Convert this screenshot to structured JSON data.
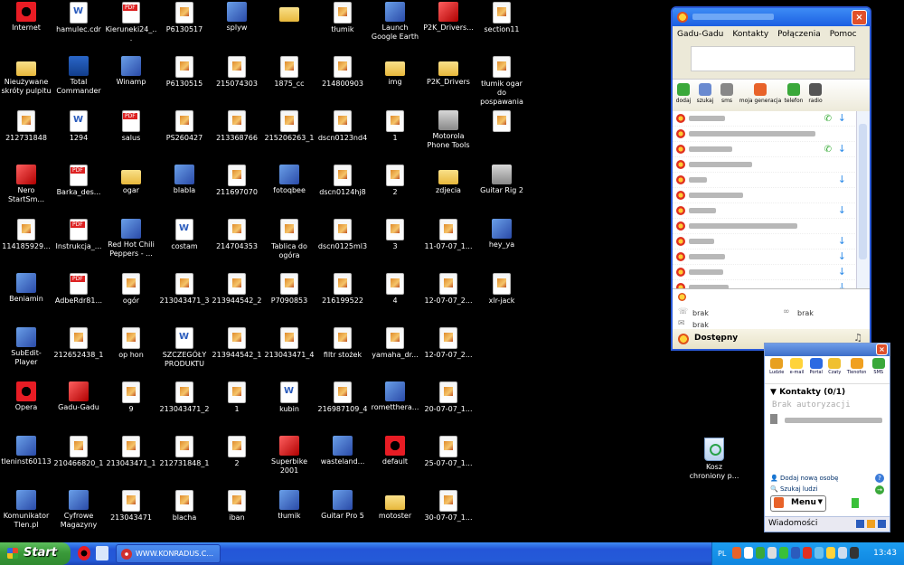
{
  "desktop": {
    "icons": [
      {
        "label": "Internet",
        "type": "opera",
        "col": 0,
        "row": 0
      },
      {
        "label": "hamulec.cdr",
        "type": "doc",
        "col": 1,
        "row": 0
      },
      {
        "label": "Kieruneki24_...",
        "type": "pdf",
        "col": 2,
        "row": 0
      },
      {
        "label": "P6130517",
        "type": "img",
        "col": 3,
        "row": 0
      },
      {
        "label": "splyw",
        "type": "gen",
        "col": 4,
        "row": 0
      },
      {
        "label": "",
        "type": "folder",
        "col": 5,
        "row": 0
      },
      {
        "label": "tłumik",
        "type": "img",
        "col": 6,
        "row": 0
      },
      {
        "label": "Launch Google Earth",
        "type": "gen",
        "col": 7,
        "row": 0
      },
      {
        "label": "P2K_Drivers...",
        "type": "red",
        "col": 8,
        "row": 0
      },
      {
        "label": "section11",
        "type": "img",
        "col": 9,
        "row": 0
      },
      {
        "label": "Nieużywane skróty pulpitu",
        "type": "folder",
        "col": 0,
        "row": 1
      },
      {
        "label": "Total Commander",
        "type": "disk",
        "col": 1,
        "row": 1
      },
      {
        "label": "Winamp",
        "type": "gen",
        "col": 2,
        "row": 1
      },
      {
        "label": "P6130515",
        "type": "img",
        "col": 3,
        "row": 1
      },
      {
        "label": "215074303",
        "type": "img",
        "col": 4,
        "row": 1
      },
      {
        "label": "1875_cc",
        "type": "img",
        "col": 5,
        "row": 1
      },
      {
        "label": "214800903",
        "type": "img",
        "col": 6,
        "row": 1
      },
      {
        "label": "img",
        "type": "folder",
        "col": 7,
        "row": 1
      },
      {
        "label": "P2K_Drivers",
        "type": "folder",
        "col": 8,
        "row": 1
      },
      {
        "label": "tłumik ogar do pospawania",
        "type": "img",
        "col": 9,
        "row": 1
      },
      {
        "label": "212731848",
        "type": "img",
        "col": 0,
        "row": 2
      },
      {
        "label": "1294",
        "type": "doc",
        "col": 1,
        "row": 2
      },
      {
        "label": "salus",
        "type": "pdf",
        "col": 2,
        "row": 2
      },
      {
        "label": "PS260427",
        "type": "img",
        "col": 3,
        "row": 2
      },
      {
        "label": "213368766",
        "type": "img",
        "col": 4,
        "row": 2
      },
      {
        "label": "215206263_1",
        "type": "img",
        "col": 5,
        "row": 2
      },
      {
        "label": "dscn0123nd4",
        "type": "img",
        "col": 6,
        "row": 2
      },
      {
        "label": "1",
        "type": "img",
        "col": 7,
        "row": 2
      },
      {
        "label": "Motorola Phone Tools",
        "type": "grey",
        "col": 8,
        "row": 2
      },
      {
        "label": "",
        "type": "img",
        "col": 9,
        "row": 2
      },
      {
        "label": "Nero StartSm...",
        "type": "red",
        "col": 0,
        "row": 3
      },
      {
        "label": "Barka_des...",
        "type": "pdf",
        "col": 1,
        "row": 3
      },
      {
        "label": "ogar",
        "type": "folder",
        "col": 2,
        "row": 3
      },
      {
        "label": "blabla",
        "type": "gen",
        "col": 3,
        "row": 3
      },
      {
        "label": "211697070",
        "type": "img",
        "col": 4,
        "row": 3
      },
      {
        "label": "fotoqbee",
        "type": "gen",
        "col": 5,
        "row": 3
      },
      {
        "label": "dscn0124hj8",
        "type": "img",
        "col": 6,
        "row": 3
      },
      {
        "label": "2",
        "type": "img",
        "col": 7,
        "row": 3
      },
      {
        "label": "zdjecia",
        "type": "folder",
        "col": 8,
        "row": 3
      },
      {
        "label": "Guitar Rig 2",
        "type": "grey",
        "col": 9,
        "row": 3
      },
      {
        "label": "114185929...",
        "type": "img",
        "col": 0,
        "row": 4
      },
      {
        "label": "Instrukcja_...",
        "type": "pdf",
        "col": 1,
        "row": 4
      },
      {
        "label": "Red Hot Chili Peppers - ...",
        "type": "gen",
        "col": 2,
        "row": 4
      },
      {
        "label": "costam",
        "type": "doc",
        "col": 3,
        "row": 4
      },
      {
        "label": "214704353",
        "type": "img",
        "col": 4,
        "row": 4
      },
      {
        "label": "Tablica do ogóra",
        "type": "img",
        "col": 5,
        "row": 4
      },
      {
        "label": "dscn0125ml3",
        "type": "img",
        "col": 6,
        "row": 4
      },
      {
        "label": "3",
        "type": "img",
        "col": 7,
        "row": 4
      },
      {
        "label": "11-07-07_1...",
        "type": "img",
        "col": 8,
        "row": 4
      },
      {
        "label": "hey_ya",
        "type": "gen",
        "col": 9,
        "row": 4
      },
      {
        "label": "Beniamin",
        "type": "gen",
        "col": 0,
        "row": 5
      },
      {
        "label": "AdbeRdr81...",
        "type": "pdf",
        "col": 1,
        "row": 5
      },
      {
        "label": "ogór",
        "type": "img",
        "col": 2,
        "row": 5
      },
      {
        "label": "213043471_3",
        "type": "img",
        "col": 3,
        "row": 5
      },
      {
        "label": "213944542_2",
        "type": "img",
        "col": 4,
        "row": 5
      },
      {
        "label": "P7090853",
        "type": "img",
        "col": 5,
        "row": 5
      },
      {
        "label": "216199522",
        "type": "img",
        "col": 6,
        "row": 5
      },
      {
        "label": "4",
        "type": "img",
        "col": 7,
        "row": 5
      },
      {
        "label": "12-07-07_2...",
        "type": "img",
        "col": 8,
        "row": 5
      },
      {
        "label": "xlr-jack",
        "type": "img",
        "col": 9,
        "row": 5
      },
      {
        "label": "SubEdit-Player",
        "type": "gen",
        "col": 0,
        "row": 6
      },
      {
        "label": "212652438_1",
        "type": "img",
        "col": 1,
        "row": 6
      },
      {
        "label": "op hon",
        "type": "img",
        "col": 2,
        "row": 6
      },
      {
        "label": "SZCZEGÓŁY PRODUKTU",
        "type": "doc",
        "col": 3,
        "row": 6
      },
      {
        "label": "213944542_1",
        "type": "img",
        "col": 4,
        "row": 6
      },
      {
        "label": "213043471_4",
        "type": "img",
        "col": 5,
        "row": 6
      },
      {
        "label": "filtr stożek",
        "type": "img",
        "col": 6,
        "row": 6
      },
      {
        "label": "yamaha_dr...",
        "type": "img",
        "col": 7,
        "row": 6
      },
      {
        "label": "12-07-07_2...",
        "type": "img",
        "col": 8,
        "row": 6
      },
      {
        "label": "Opera",
        "type": "opera",
        "col": 0,
        "row": 7
      },
      {
        "label": "Gadu-Gadu",
        "type": "red",
        "col": 1,
        "row": 7
      },
      {
        "label": "9",
        "type": "img",
        "col": 2,
        "row": 7
      },
      {
        "label": "213043471_2",
        "type": "img",
        "col": 3,
        "row": 7
      },
      {
        "label": "1",
        "type": "img",
        "col": 4,
        "row": 7
      },
      {
        "label": "kubin",
        "type": "doc",
        "col": 5,
        "row": 7
      },
      {
        "label": "216987109_4",
        "type": "img",
        "col": 6,
        "row": 7
      },
      {
        "label": "rometthera...",
        "type": "gen",
        "col": 7,
        "row": 7
      },
      {
        "label": "20-07-07_1...",
        "type": "img",
        "col": 8,
        "row": 7
      },
      {
        "label": "tleninst60113",
        "type": "gen",
        "col": 0,
        "row": 8
      },
      {
        "label": "210466820_1",
        "type": "img",
        "col": 1,
        "row": 8
      },
      {
        "label": "213043471_1",
        "type": "img",
        "col": 2,
        "row": 8
      },
      {
        "label": "212731848_1",
        "type": "img",
        "col": 3,
        "row": 8
      },
      {
        "label": "2",
        "type": "img",
        "col": 4,
        "row": 8
      },
      {
        "label": "Superbike 2001",
        "type": "red",
        "col": 5,
        "row": 8
      },
      {
        "label": "wasteland...",
        "type": "gen",
        "col": 6,
        "row": 8
      },
      {
        "label": "default",
        "type": "opera",
        "col": 7,
        "row": 8
      },
      {
        "label": "25-07-07_1...",
        "type": "img",
        "col": 8,
        "row": 8
      },
      {
        "label": "Komunikator Tlen.pl",
        "type": "gen",
        "col": 0,
        "row": 9
      },
      {
        "label": "Cyfrowe Magazyny",
        "type": "gen",
        "col": 1,
        "row": 9
      },
      {
        "label": "213043471",
        "type": "img",
        "col": 2,
        "row": 9
      },
      {
        "label": "blacha",
        "type": "img",
        "col": 3,
        "row": 9
      },
      {
        "label": "iban",
        "type": "img",
        "col": 4,
        "row": 9
      },
      {
        "label": "tłumik",
        "type": "gen",
        "col": 5,
        "row": 9
      },
      {
        "label": "Guitar Pro 5",
        "type": "gen",
        "col": 6,
        "row": 9
      },
      {
        "label": "motoster",
        "type": "folder",
        "col": 7,
        "row": 9
      },
      {
        "label": "30-07-07_1...",
        "type": "img",
        "col": 8,
        "row": 9
      }
    ],
    "recycle_bin": {
      "label": "Kosz chroniony p..."
    }
  },
  "gg": {
    "menu": [
      "Gadu-Gadu",
      "Kontakty",
      "Połączenia",
      "Pomoc"
    ],
    "tools": [
      {
        "label": "dodaj",
        "color": "#3aa83a"
      },
      {
        "label": "szukaj",
        "color": "#6a8ad0"
      },
      {
        "label": "sms",
        "color": "#888888"
      },
      {
        "label": "moja generacja",
        "color": "#e8632a"
      },
      {
        "label": "telefon",
        "color": "#3aa83a"
      },
      {
        "label": "radio",
        "color": "#555555"
      }
    ],
    "contacts": [
      {
        "name_w": 40,
        "phone": true,
        "arrow": true
      },
      {
        "name_w": 140,
        "phone": false,
        "arrow": false
      },
      {
        "name_w": 48,
        "phone": true,
        "arrow": true
      },
      {
        "name_w": 70,
        "phone": false,
        "arrow": false
      },
      {
        "name_w": 20,
        "phone": false,
        "arrow": true
      },
      {
        "name_w": 60,
        "phone": false,
        "arrow": false
      },
      {
        "name_w": 30,
        "phone": false,
        "arrow": true
      },
      {
        "name_w": 120,
        "phone": false,
        "arrow": false
      },
      {
        "name_w": 28,
        "phone": false,
        "arrow": true
      },
      {
        "name_w": 40,
        "phone": false,
        "arrow": true
      },
      {
        "name_w": 38,
        "phone": false,
        "arrow": true
      },
      {
        "name_w": 44,
        "phone": false,
        "arrow": true
      }
    ],
    "info": {
      "phone1": "brak",
      "phone2": "brak",
      "email": "brak"
    },
    "status": "Dostępny"
  },
  "tlen": {
    "tools": [
      "Ludzie",
      "e-mail",
      "Portal",
      "Czaty",
      "Tlenofon",
      "SMS"
    ],
    "group": "Kontakty (0/1)",
    "no_auth": "Brak autoryzacji",
    "add": "Dodaj nową osobę",
    "search": "Szukaj ludzi",
    "menu": "Menu",
    "messages": "Wiadomości"
  },
  "taskbar": {
    "start": "Start",
    "window": "WWW.KONRADUS.C...",
    "lang": "PL",
    "clock": "13:43"
  }
}
